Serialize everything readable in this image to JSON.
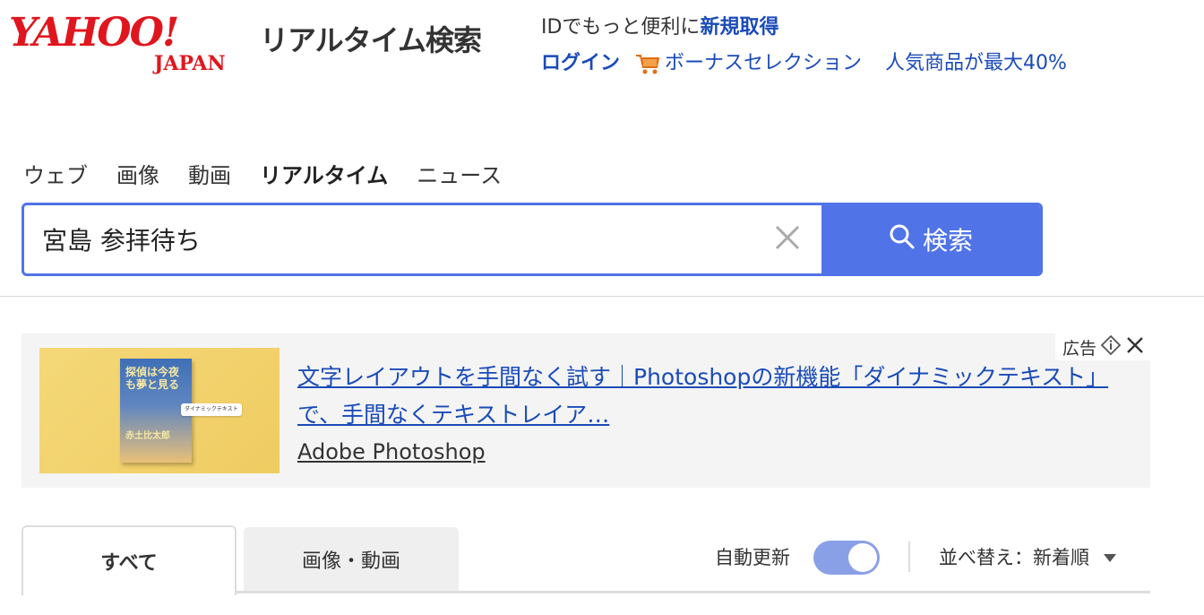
{
  "header": {
    "logo_main": "YAHOO!",
    "logo_sub": "JAPAN",
    "service_title": "リアルタイム検索",
    "id_prompt": "IDでもっと便利に",
    "signup_link": "新規取得",
    "login_link": "ログイン",
    "bonus_link": "ボーナスセレクション",
    "popular_link": "人気商品が最大40%"
  },
  "nav": {
    "tabs": [
      {
        "label": "ウェブ",
        "active": false
      },
      {
        "label": "画像",
        "active": false
      },
      {
        "label": "動画",
        "active": false
      },
      {
        "label": "リアルタイム",
        "active": true
      },
      {
        "label": "ニュース",
        "active": false
      }
    ]
  },
  "search": {
    "query": "宮島 参拝待ち",
    "button_label": "検索"
  },
  "ad": {
    "label": "広告",
    "title": "文字レイアウトを手間なく試す｜Photoshopの新機能「ダイナミックテキスト」で、手間なくテキストレイア…",
    "source": "Adobe Photoshop",
    "thumb_book_title": "探偵は今夜も夢と見る",
    "thumb_book_author": "赤土比太郎",
    "thumb_tag": "ダイナミックテキスト"
  },
  "results": {
    "tab_all": "すべて",
    "tab_media": "画像・動画",
    "auto_update_label": "自動更新",
    "auto_update_on": true,
    "sort_label": "並べ替え：新着順"
  },
  "colors": {
    "brand_red": "#e0161e",
    "link_blue": "#1a4bb8",
    "search_accent": "#5073e8",
    "toggle_on": "#8aa0e6"
  },
  "icons": [
    "cart-icon",
    "search-icon",
    "clear-icon",
    "info-icon",
    "close-icon",
    "sort-caret-icon"
  ]
}
